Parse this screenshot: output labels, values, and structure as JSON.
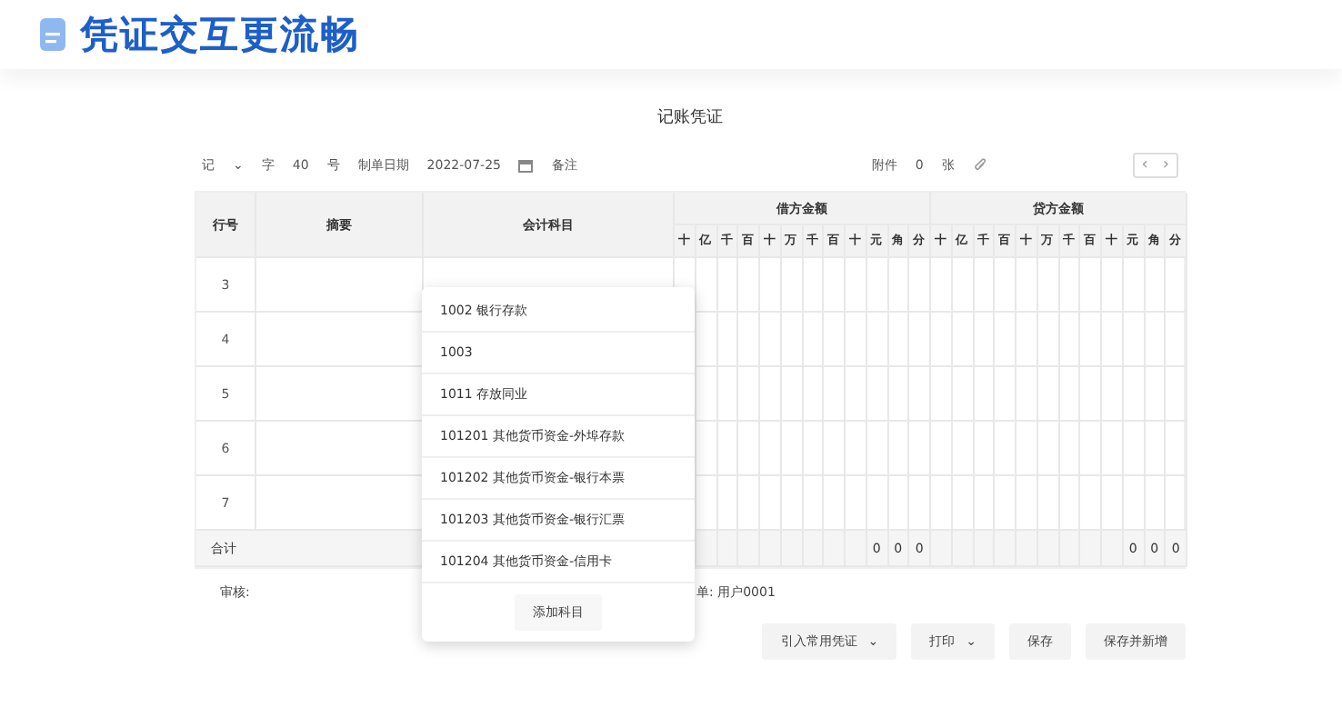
{
  "header": {
    "title": "凭证交互更流畅"
  },
  "voucher": {
    "title": "记账凭证",
    "toolbar": {
      "voucher_type": "记",
      "type_caret": "⌄",
      "word_label": "字",
      "number": "40",
      "number_suffix": "号",
      "date_label": "制单日期",
      "date": "2022-07-25",
      "note_label": "备注",
      "attachment_label": "附件",
      "attachment_count": "0",
      "attachment_unit": "张",
      "prev": "‹",
      "next": "›"
    },
    "columns": {
      "row_number": "行号",
      "summary": "摘要",
      "account": "会计科目",
      "debit": "借方金额",
      "credit": "贷方金额",
      "debit_digits": [
        "十",
        "亿",
        "千",
        "百",
        "十",
        "万",
        "千",
        "百",
        "十",
        "元",
        "角",
        "分"
      ],
      "credit_digits": [
        "十",
        "亿",
        "千",
        "百",
        "十",
        "万",
        "千",
        "百",
        "十",
        "元",
        "角",
        "分"
      ]
    },
    "rows": [
      {
        "number": "3"
      },
      {
        "number": "4"
      },
      {
        "number": "5"
      },
      {
        "number": "6"
      },
      {
        "number": "7"
      }
    ],
    "total": {
      "label": "合计",
      "debit_digits": [
        "0",
        "0",
        "0"
      ],
      "credit_digits": [
        "0",
        "0",
        "0"
      ]
    },
    "reviewer_label": "审核:",
    "maker": "单: 用户0001",
    "buttons": [
      {
        "label": "引入常用凭证",
        "caret": "⌄"
      },
      {
        "label": "打印",
        "caret": "⌄"
      },
      {
        "label": "保存"
      },
      {
        "label": "保存并新增"
      }
    ]
  },
  "account_dropdown": {
    "items": [
      {
        "label": "1002 银行存款"
      },
      {
        "label": "1003"
      },
      {
        "label": "1011 存放同业"
      },
      {
        "label": "101201 其他货币资金-外埠存款"
      },
      {
        "label": "101202 其他货币资金-银行本票"
      },
      {
        "label": "101203 其他货币资金-银行汇票"
      },
      {
        "label": "101204 其他货币资金-信用卡"
      }
    ],
    "add_button": "添加科目"
  }
}
